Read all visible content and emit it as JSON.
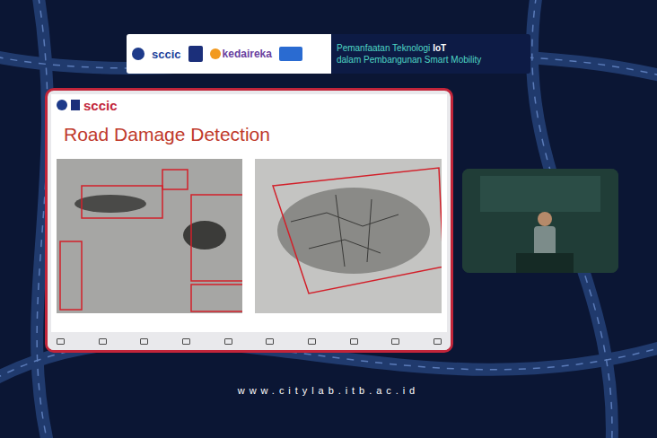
{
  "banner": {
    "logos": [
      "sccic",
      "kedaireka"
    ],
    "title_parts": [
      {
        "text": "Pemanfaatan Teknologi ",
        "bold": false
      },
      {
        "text": "IoT",
        "bold": true
      }
    ],
    "subtitle": "dalam Pembangunan Smart Mobility"
  },
  "slide": {
    "logo": "sccic",
    "title": "Road Damage Detection"
  },
  "footer": "www.citylab.itb.ac.id"
}
